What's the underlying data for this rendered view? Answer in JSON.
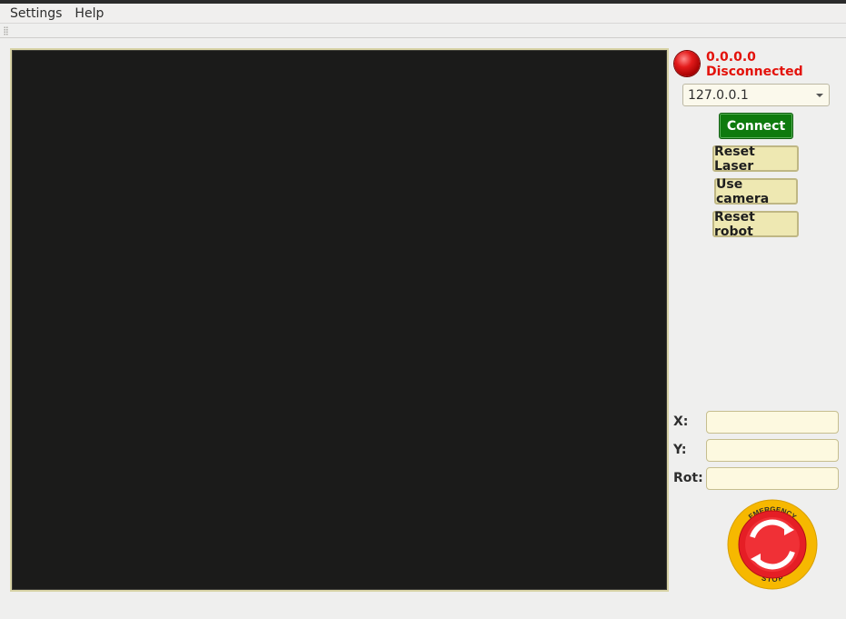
{
  "menu": {
    "items": [
      "Settings",
      "Help"
    ]
  },
  "status": {
    "ip": "0.0.0.0",
    "text": "Disconnected",
    "led_color": "#e31b1b"
  },
  "connection": {
    "selected_ip": "127.0.0.1"
  },
  "buttons": {
    "connect": "Connect",
    "reset_laser": "Reset Laser",
    "use_camera": "Use camera",
    "reset_robot": "Reset robot"
  },
  "coords": {
    "x_label": "X:",
    "x_value": "",
    "y_label": "Y:",
    "y_value": "",
    "rot_label": "Rot:",
    "rot_value": ""
  },
  "emergency_stop": {
    "top_text": "EMERGENCY",
    "bottom_text": "STOP",
    "icon": "emergency-stop-icon"
  },
  "colors": {
    "video_bg": "#1b1b1a",
    "connect_green": "#0e7a0e",
    "button_beige": "#eee8b2",
    "status_red": "#e3120b",
    "estop_yellow": "#f6b800"
  }
}
